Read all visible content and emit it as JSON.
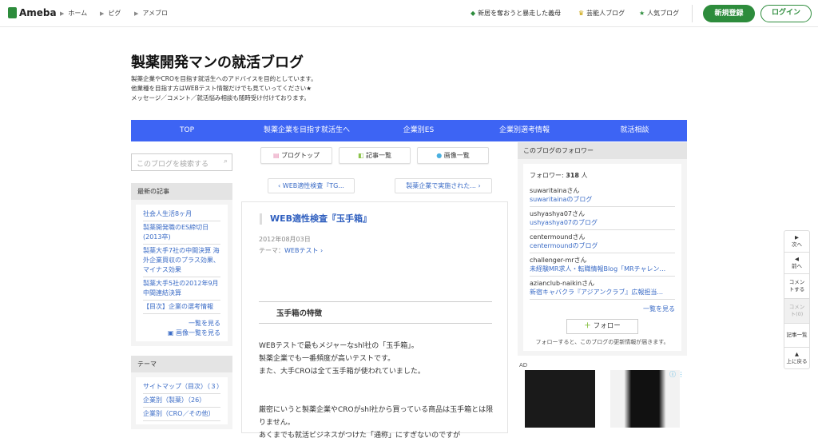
{
  "header": {
    "logo": "Ameba",
    "breadcrumbs": [
      "ホーム",
      "ピグ",
      "アメブロ"
    ],
    "links": [
      {
        "icon": "diamond-icon",
        "label": "新居を奪おうと暴走した義母"
      },
      {
        "icon": "crown-icon",
        "label": "芸能人ブログ"
      },
      {
        "icon": "star-icon",
        "label": "人気ブログ"
      }
    ],
    "register": "新規登録",
    "login": "ログイン"
  },
  "blog": {
    "title": "製薬開発マンの就活ブログ",
    "description": [
      "製薬企業やCROを目指す就活生へのアドバイスを目的としています。",
      "他業種を目指す方はWEBテスト情報だけでも見ていってください★",
      "メッセージ／コメント／就活悩み相談も随時受け付けております。"
    ]
  },
  "nav": [
    "TOP",
    "製薬企業を目指す就活生へ",
    "企業別ES",
    "企業別選考情報",
    "就活相談"
  ],
  "left": {
    "search_placeholder": "このブログを検索する",
    "recent_title": "最新の記事",
    "recent": [
      "社会人生活8ヶ月",
      "製薬開発職のES締切日(2013卒)",
      "製薬大手7社の中間決算 海外企業買収のプラス効果、マイナス効果",
      "製薬大手5社の2012年9月中間連結決算",
      "【目次】企業の選考情報"
    ],
    "see_all": "一覧を見る",
    "see_images": "画像一覧を見る",
    "theme_title": "テーマ",
    "themes": [
      "サイトマップ（目次）（３）",
      "企業別（製薬）（26）",
      "企業別（CRO／その他）"
    ]
  },
  "toolbar": {
    "blog_top": "ブログトップ",
    "articles": "記事一覧",
    "images": "画像一覧"
  },
  "pager": {
    "prev": "WEB適性検査『TG...",
    "next": "製薬企業で実施された..."
  },
  "article": {
    "title": "WEB適性検査『玉手箱』",
    "date": "2012年08月03日",
    "theme_label": "テーマ：",
    "theme": "WEBテスト",
    "heading": "玉手箱の特徴",
    "paragraphs": [
      [
        "WEBテストで最もメジャーなshl社の「玉手箱」。",
        "製薬企業でも一番頻度が高いテストです。",
        "また、大手CROは全て玉手箱が使われていました。"
      ],
      [
        "厳密にいうと製薬企業やCROがshl社から買っている商品は玉手箱とは限りません。",
        "あくまでも就活ビジネスがつけた「通称」にすぎないのですが"
      ]
    ]
  },
  "followers": {
    "title": "このブログのフォロワー",
    "count_label": "フォロワー: ",
    "count": "318",
    "unit": " 人",
    "list": [
      {
        "name": "suwaritainaさん",
        "blog": "suwaritainaのブログ"
      },
      {
        "name": "ushyashya07さん",
        "blog": "ushyashya07のブログ"
      },
      {
        "name": "centermoundさん",
        "blog": "centermoundのブログ"
      },
      {
        "name": "challenger-mrさん",
        "blog": "未経験MR求人・転職情報Blog「MRチャレン..."
      },
      {
        "name": "azianclub-naikinさん",
        "blog": "新宿キャバクラ『アジアンクラブ』広報担当..."
      }
    ],
    "see_all": "一覧を見る",
    "follow": "フォロー",
    "note": "フォローすると、このブログの更新情報が届きます。"
  },
  "ad": {
    "label": "AD"
  },
  "side": {
    "next": "次へ",
    "prev": "前へ",
    "comment": "コメントする",
    "comments": "コメント(0)",
    "articles": "記事一覧",
    "top": "上に戻る"
  },
  "colors": {
    "brand": "#2d8c3c",
    "nav": "#3d64f4",
    "link": "#3a6bc6"
  }
}
